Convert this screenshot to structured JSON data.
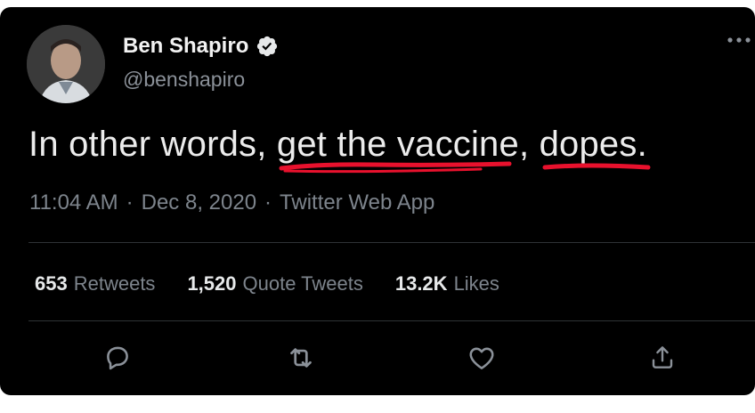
{
  "author": {
    "display_name": "Ben Shapiro",
    "handle": "@benshapiro",
    "verified": true
  },
  "tweet": {
    "text_part1": "In other words, ",
    "text_underlined1": "get the vaccine",
    "text_part2": ", ",
    "text_underlined2": "dopes",
    "text_part3": ".",
    "underline_color": "#e8112d"
  },
  "meta": {
    "time": "11:04 AM",
    "date": "Dec 8, 2020",
    "source": "Twitter Web App",
    "separator": "·"
  },
  "stats": {
    "retweets_count": "653",
    "retweets_label": "Retweets",
    "quotes_count": "1,520",
    "quotes_label": "Quote Tweets",
    "likes_count": "13.2K",
    "likes_label": "Likes"
  },
  "actions": [
    "reply-icon",
    "retweet-icon",
    "like-icon",
    "share-icon"
  ],
  "colors": {
    "background": "#000000",
    "text": "#e7e9ea",
    "secondary": "#7d848c",
    "divider": "#2f3336"
  }
}
